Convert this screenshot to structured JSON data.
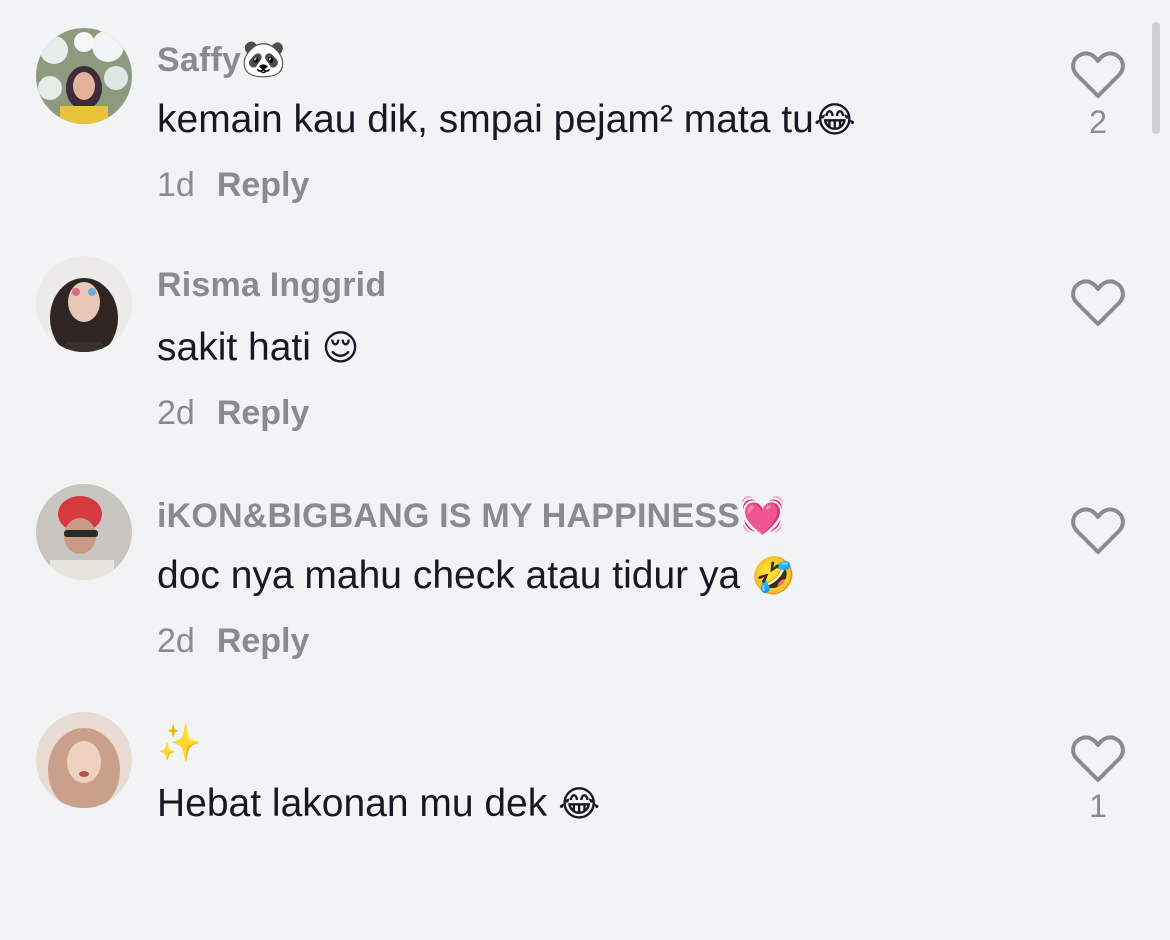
{
  "comments": [
    {
      "username": "Saffy",
      "username_emoji": "🐼",
      "text": "kemain kau dik, smpai pejam² mata tu",
      "text_emoji": "😂",
      "time": "1d",
      "reply_label": "Reply",
      "likes": "2",
      "avatar_icon": "avatar-flowers-hijab"
    },
    {
      "username": "Risma Inggrid",
      "username_emoji": "",
      "text": "sakit hati ",
      "text_emoji": "😌",
      "time": "2d",
      "reply_label": "Reply",
      "likes": "",
      "avatar_icon": "avatar-girl-long-hair"
    },
    {
      "username": "iKON&BIGBANG IS MY HAPPINESS",
      "username_emoji": "💓",
      "text": "doc nya mahu check atau tidur ya ",
      "text_emoji": "🤣",
      "time": "2d",
      "reply_label": "Reply",
      "likes": "",
      "avatar_icon": "avatar-red-hair"
    },
    {
      "username": "",
      "username_emoji": "✨",
      "text": "Hebat lakonan mu dek ",
      "text_emoji": "😂",
      "time": "",
      "reply_label": "",
      "likes": "1",
      "avatar_icon": "avatar-hijab-woman"
    }
  ],
  "colors": {
    "background": "#f2f3f5",
    "text_primary": "#161823",
    "text_secondary": "#8a8b91",
    "icon": "#8a8b91"
  },
  "icons": {
    "like": "heart-outline-icon"
  }
}
